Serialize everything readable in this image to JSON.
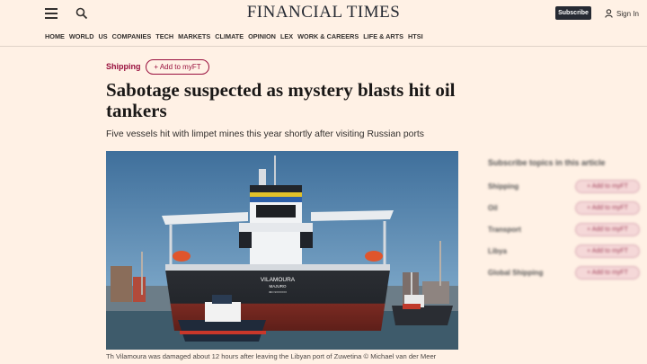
{
  "header": {
    "logo": "FINANCIAL TIMES",
    "subscribe_label": "Subscribe",
    "signin_label": "Sign In",
    "nav": [
      "HOME",
      "WORLD",
      "US",
      "COMPANIES",
      "TECH",
      "MARKETS",
      "CLIMATE",
      "OPINION",
      "LEX",
      "WORK & CAREERS",
      "LIFE & ARTS",
      "HTSI"
    ]
  },
  "article": {
    "topic": "Shipping",
    "myft_label": "+ Add to myFT",
    "headline": "Sabotage suspected as mystery blasts hit oil tankers",
    "standfirst": "Five vessels hit with limpet mines this year shortly after visiting Russian ports",
    "photo": {
      "ship_name": "VILAMOURA",
      "port": "MAJURO",
      "imo": "IMO 9XXXXXX"
    },
    "caption": "Th Vilamoura was damaged about 12 hours after leaving the Libyan port of Zuwetina © Michael van der Meer"
  },
  "sidebar": {
    "heading": "Subscribe topics in this article",
    "topics": [
      "Shipping",
      "Oil",
      "Transport",
      "Libya",
      "Global Shipping"
    ],
    "follow_label": "+ Add to myFT"
  },
  "colors": {
    "page_bg": "#fff1e5",
    "claret": "#990f3d",
    "header_dark": "#262a33"
  }
}
